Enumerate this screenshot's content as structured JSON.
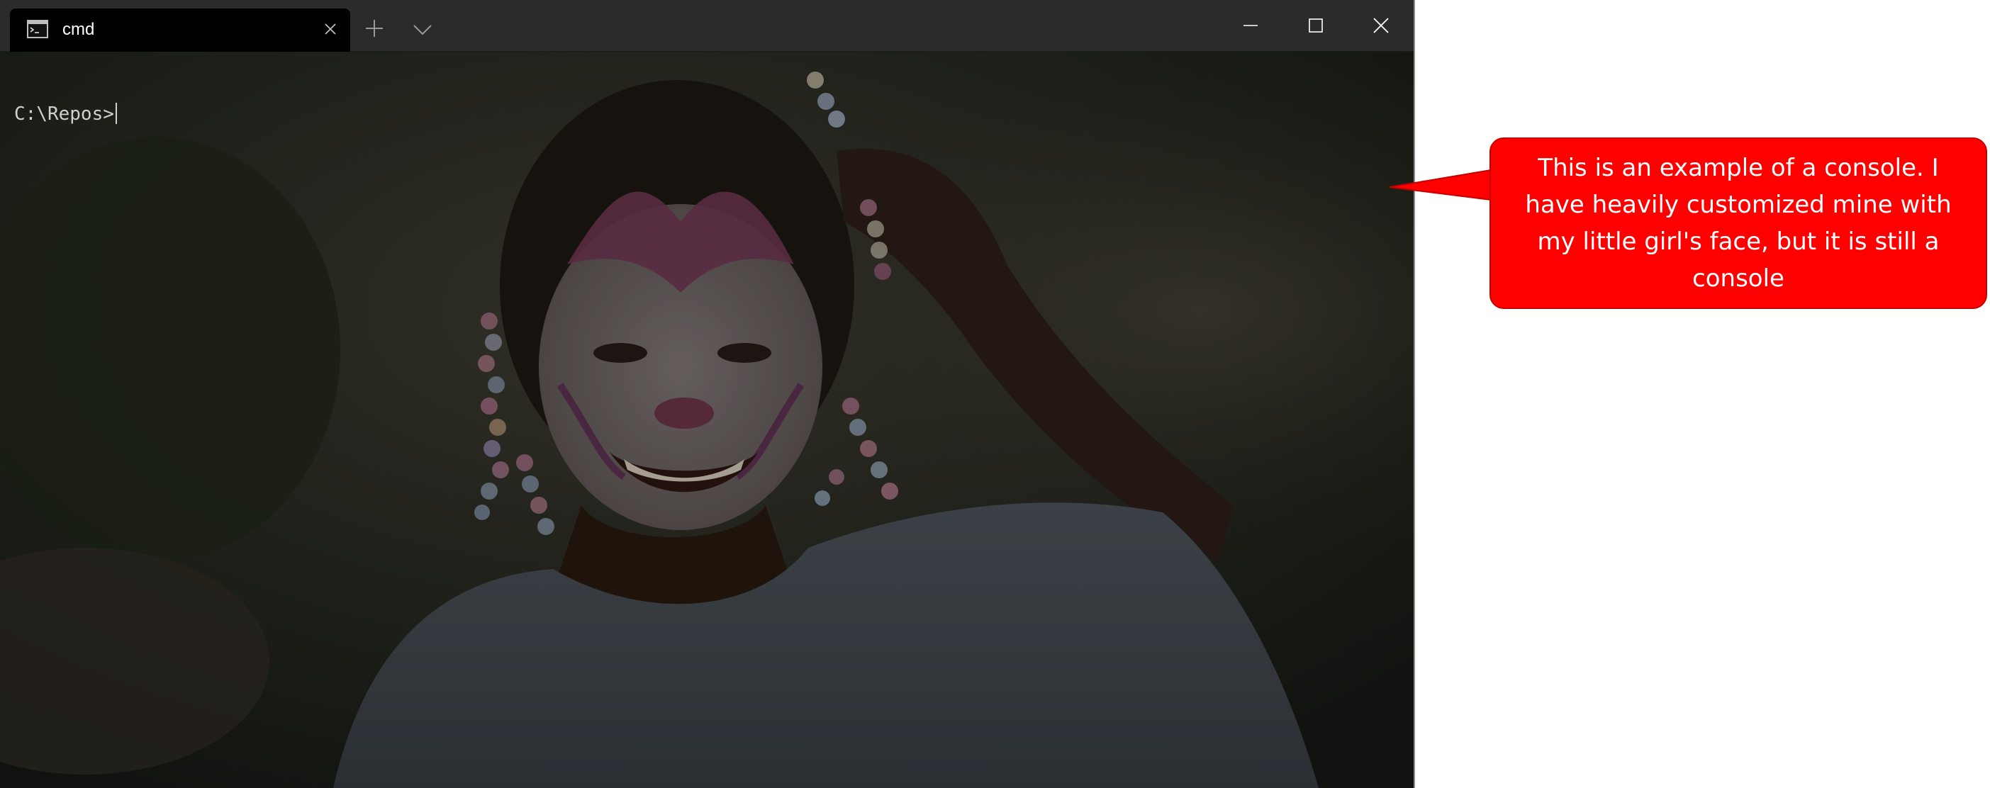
{
  "window": {
    "tab_title": "cmd",
    "tab_icon": "cmd-icon",
    "controls": [
      "close-tab-icon",
      "plus-icon",
      "chevron-down-icon",
      "minimize-icon",
      "maximize-icon",
      "close-icon"
    ]
  },
  "terminal": {
    "prompt": "C:\\Repos>",
    "background": "photo of a smiling girl with face paint and beaded braids"
  },
  "callout": {
    "text": "This is an example of a console. I have heavily customized mine with my little girl's face, but it is still a console",
    "color": "#ff0000"
  }
}
